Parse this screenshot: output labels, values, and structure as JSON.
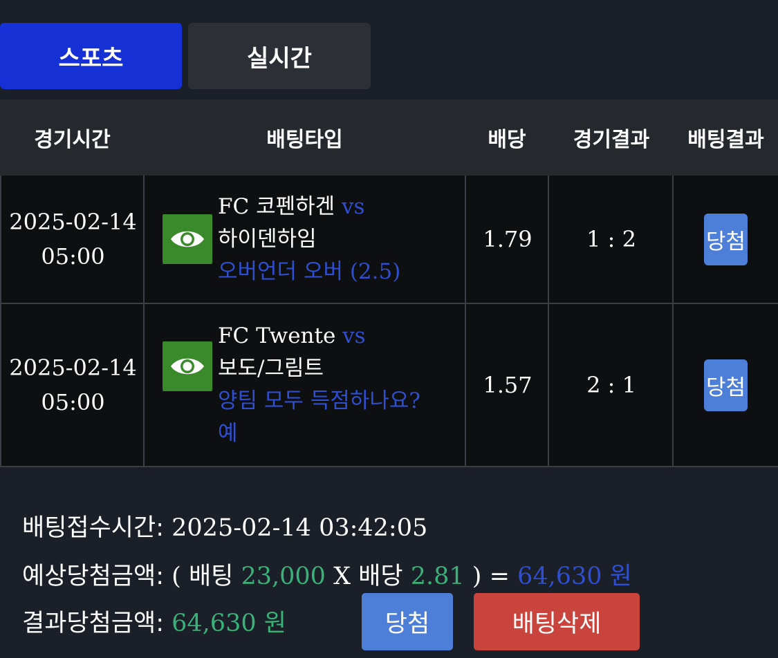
{
  "tabs": {
    "sports": "스포츠",
    "live": "실시간"
  },
  "columns": [
    "경기시간",
    "배팅타입",
    "배당",
    "경기결과",
    "배팅결과"
  ],
  "rows": [
    {
      "date": "2025-02-14",
      "time": "05:00",
      "team_home": "FC 코펜하겐",
      "vs": "vs",
      "team_away": "하이덴하임",
      "bet_type_1": "오버언더 오버 (2.5)",
      "bet_type_2": "",
      "odds": "1.79",
      "score": "1 : 2",
      "result": "당첨"
    },
    {
      "date": "2025-02-14",
      "time": "05:00",
      "team_home": "FC Twente",
      "vs": "vs",
      "team_away": "보도/그림트",
      "bet_type_1": "양팀 모두 득점하나요?",
      "bet_type_2": "예",
      "odds": "1.57",
      "score": "2 : 1",
      "result": "당첨"
    }
  ],
  "summary": {
    "receipt_label": "배팅접수시간:",
    "receipt_time": "2025-02-14 03:42:05",
    "expected_label": "예상당첨금액:",
    "open_paren": "(",
    "bet_word": "배팅",
    "bet_amount": "23,000",
    "times": "X",
    "odds_word": "배당",
    "total_odds": "2.81",
    "close_paren": ")",
    "equals": "=",
    "expected_amount": "64,630 원",
    "result_label": "결과당첨금액:",
    "result_amount": "64,630 원"
  },
  "buttons": {
    "win": "당첨",
    "delete": "배팅삭제"
  },
  "colors": {
    "accent_blue": "#1530d4",
    "win_blue": "#4d7fd9",
    "delete_red": "#c9443d",
    "eye_green": "#3a8a2c",
    "value_green": "#3bb17a",
    "link_blue": "#2f4fd0"
  },
  "icons": {
    "detail": "eye-icon"
  }
}
